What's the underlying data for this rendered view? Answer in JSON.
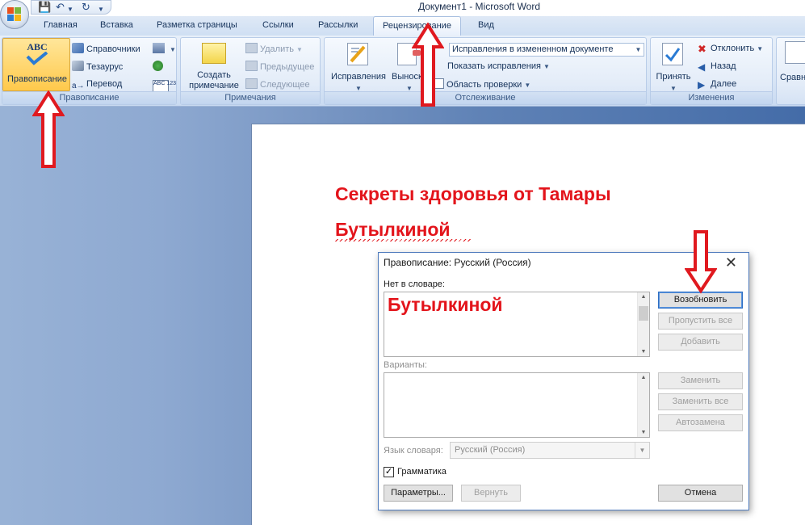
{
  "window": {
    "title": "Документ1 - Microsoft Word"
  },
  "qat": {
    "icons": [
      "save-icon",
      "undo-icon",
      "redo-icon"
    ]
  },
  "tabs": [
    {
      "label": "Главная"
    },
    {
      "label": "Вставка"
    },
    {
      "label": "Разметка страницы"
    },
    {
      "label": "Ссылки"
    },
    {
      "label": "Рассылки"
    },
    {
      "label": "Рецензирование",
      "active": true
    },
    {
      "label": "Вид"
    }
  ],
  "ribbon": {
    "proofing": {
      "label": "Правописание",
      "spelling": "Правописание",
      "research": "Справочники",
      "thesaurus": "Тезаурус",
      "translate": "Перевод",
      "abc_icon": "ABC",
      "abc123_icon": "ABC 123"
    },
    "comments": {
      "label": "Примечания",
      "new_comment_line1": "Создать",
      "new_comment_line2": "примечание",
      "delete": "Удалить",
      "previous": "Предыдущее",
      "next": "Следующее"
    },
    "tracking": {
      "label": "Отслеживание",
      "track_changes": "Исправления",
      "balloons": "Выноски",
      "display_combo": "Исправления в измененном документе",
      "show_markup": "Показать исправления",
      "reviewing_pane": "Область проверки"
    },
    "changes": {
      "label": "Изменения",
      "accept": "Принять",
      "reject": "Отклонить",
      "previous": "Назад",
      "next": "Далее"
    },
    "compare": {
      "label": "Сравн"
    }
  },
  "document": {
    "heading_line1": "Секреты здоровья от Тамары",
    "heading_line2": "Бутылкиной"
  },
  "dialog": {
    "title": "Правописание: Русский (Россия)",
    "not_in_dictionary_label": "Нет в словаре:",
    "not_in_dictionary_word": "Бутылкиной",
    "suggestions_label": "Варианты:",
    "dictionary_language_label": "Язык словаря:",
    "dictionary_language_value": "Русский (Россия)",
    "grammar_label": "Грамматика",
    "grammar_checked": true,
    "buttons": {
      "resume": "Возобновить",
      "ignore_all": "Пропустить все",
      "add": "Добавить",
      "change": "Заменить",
      "change_all": "Заменить все",
      "autocorrect": "Автозамена",
      "options": "Параметры...",
      "undo": "Вернуть",
      "cancel": "Отмена"
    }
  },
  "colors": {
    "heading_red": "#e3141b",
    "arrow_red": "#e0191f",
    "ribbon_blue": "#d9e6f6"
  }
}
